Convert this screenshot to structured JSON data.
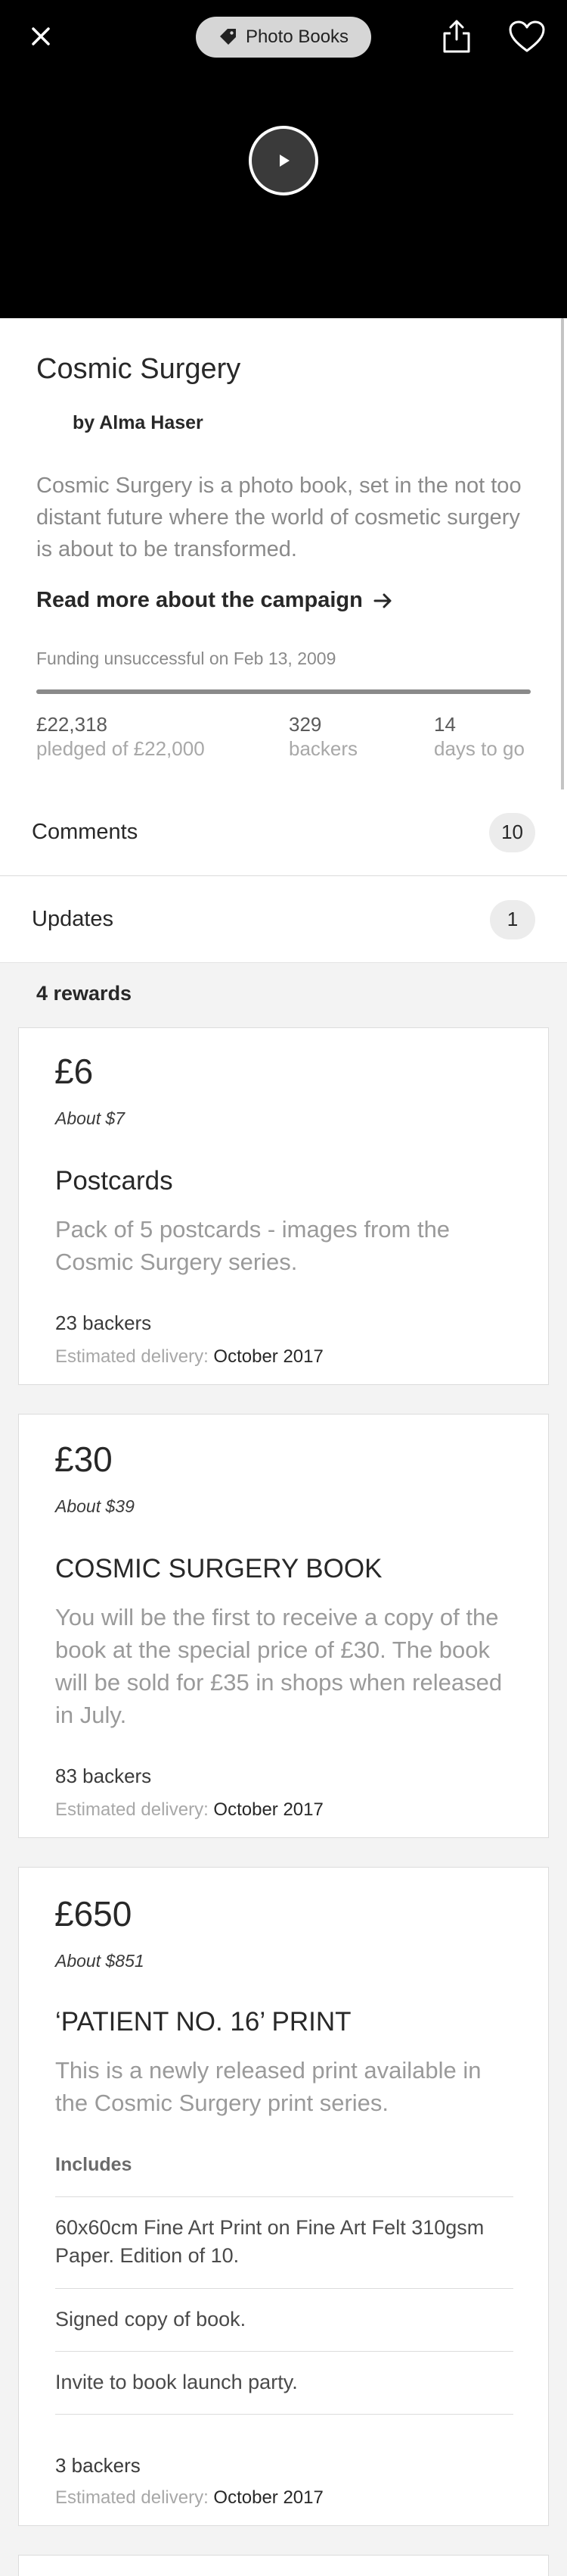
{
  "header": {
    "category_label": "Photo Books",
    "close_icon": "close-icon",
    "tag_icon": "tag-icon",
    "share_icon": "share-icon",
    "heart_icon": "heart-icon",
    "play_icon": "play-icon"
  },
  "campaign": {
    "title": "Cosmic Surgery",
    "creator": "by Alma Haser",
    "blurb": "Cosmic Surgery is a photo book, set in the not too distant future where the world of cosmetic surgery is about to be transformed.",
    "read_more": "Read more about the campaign",
    "read_more_icon": "arrow-right-icon",
    "funding_status": "Funding unsuccessful on Feb 13, 2009",
    "progress_fraction": 1.0,
    "stats": [
      {
        "value": "£22,318",
        "label": "pledged of £22,000"
      },
      {
        "value": "329",
        "label": "backers"
      },
      {
        "value": "14",
        "label": "days to go"
      }
    ]
  },
  "rows": {
    "comments_label": "Comments",
    "comments_count": "10",
    "updates_label": "Updates",
    "updates_count": "1"
  },
  "rewards_count_label": "4 rewards",
  "delivery_label": "Estimated delivery:",
  "rewards": [
    {
      "amount": "£6",
      "about": "About $7",
      "title": "Postcards",
      "description": "Pack of 5 postcards - images from the Cosmic Surgery series.",
      "backers": "23 backers",
      "delivery": "October 2017"
    },
    {
      "amount": "£30",
      "about": "About $39",
      "title": "COSMIC SURGERY BOOK",
      "description": "You will be the first to receive a copy of the book at the special price of £30. The book will be sold for £35 in shops when released in July.",
      "backers": "83 backers",
      "delivery": "October 2017"
    },
    {
      "amount": "£650",
      "about": "About $851",
      "title": "‘PATIENT NO. 16’ PRINT",
      "description": "This is a newly released print available in the Cosmic Surgery print series.",
      "includes_label": "Includes",
      "includes": [
        "60x60cm Fine Art Print on Fine Art Felt 310gsm Paper. Edition of 10.",
        "Signed copy of book.",
        "Invite to book launch party."
      ],
      "backers": "3 backers",
      "delivery": "October 2017"
    }
  ]
}
